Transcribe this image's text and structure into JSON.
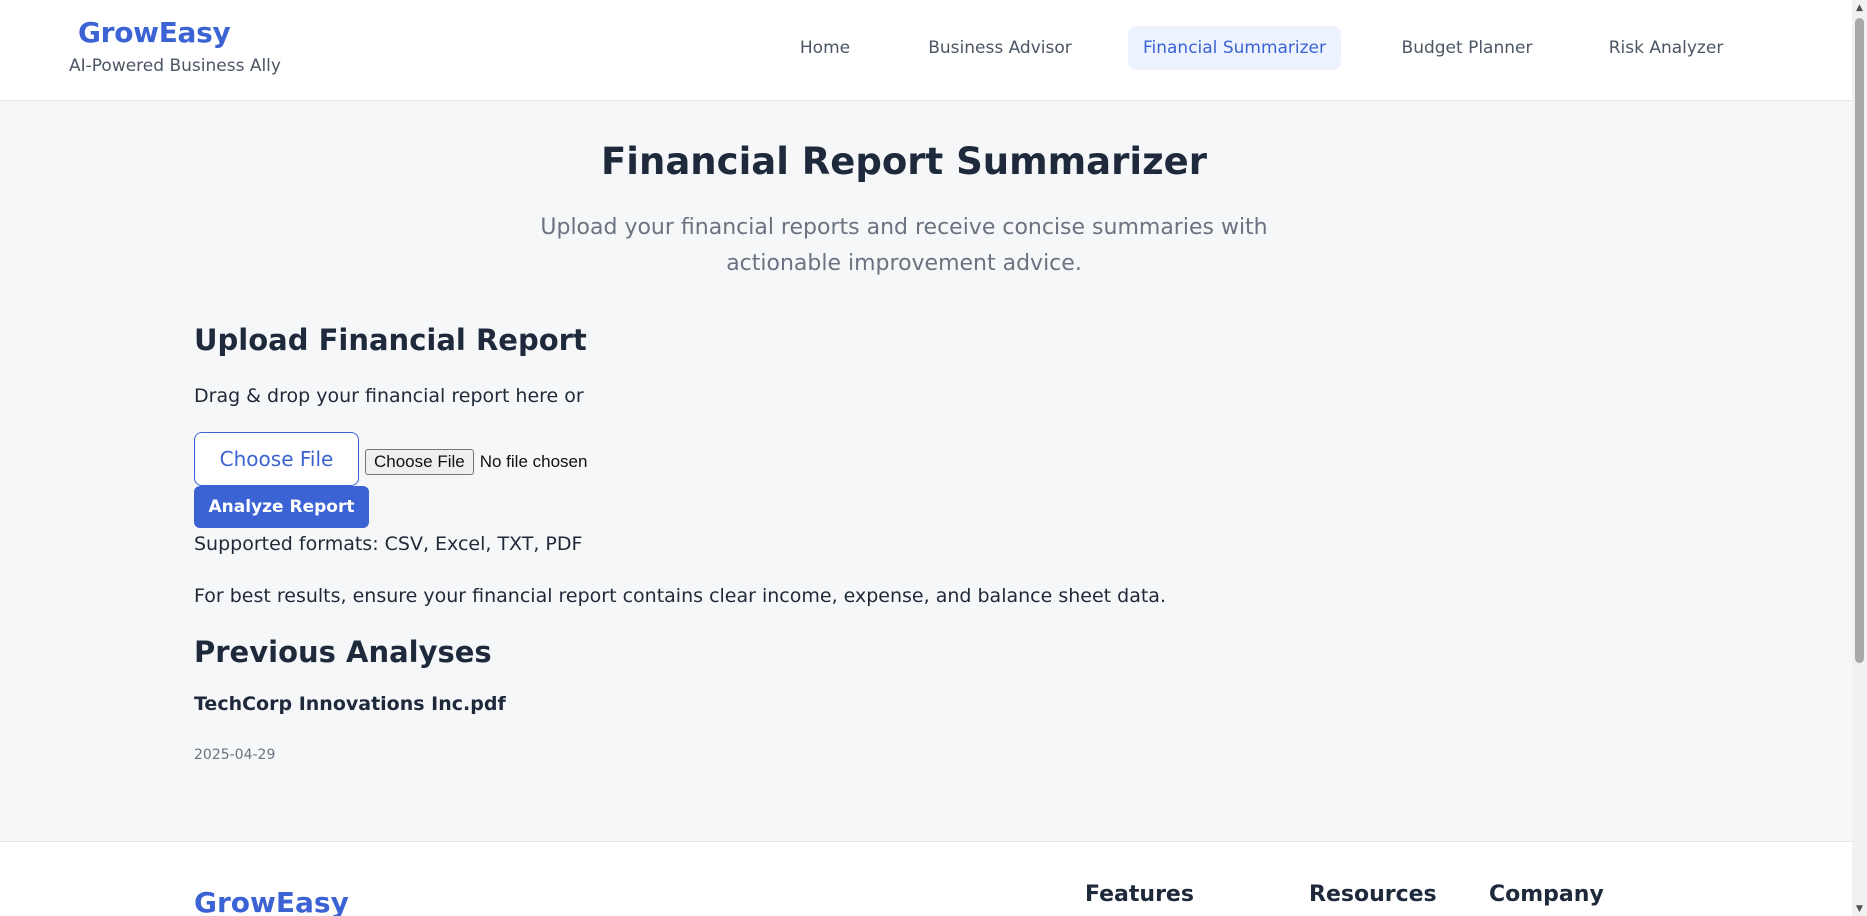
{
  "brand": {
    "title": "GrowEasy",
    "tagline": "AI-Powered Business Ally"
  },
  "nav": {
    "items": [
      {
        "label": "Home"
      },
      {
        "label": "Business Advisor"
      },
      {
        "label": "Financial Summarizer",
        "active": true
      },
      {
        "label": "Budget Planner"
      },
      {
        "label": "Risk Analyzer"
      }
    ]
  },
  "main": {
    "title": "Financial Report Summarizer",
    "subtitle": "Upload your financial reports and receive concise summaries with actionable improvement advice."
  },
  "upload": {
    "heading": "Upload Financial Report",
    "drag_text": "Drag & drop your financial report here or",
    "choose_file_label": "Choose File",
    "native_button_label": "Choose File",
    "no_file_text": "No file chosen",
    "analyze_label": "Analyze Report",
    "formats_text": "Supported formats: CSV, Excel, TXT, PDF",
    "tip_text": "For best results, ensure your financial report contains clear income, expense, and balance sheet data."
  },
  "previous": {
    "heading": "Previous Analyses",
    "items": [
      {
        "name": "TechCorp Innovations Inc.pdf",
        "date": "2025-04-29"
      }
    ]
  },
  "footer": {
    "brand": "GrowEasy",
    "headings": [
      "Features",
      "Resources",
      "Company"
    ]
  },
  "colors": {
    "accent": "#3b63d4",
    "active_nav_bg": "#edf3fe",
    "page_bg": "#f6f7f9"
  }
}
